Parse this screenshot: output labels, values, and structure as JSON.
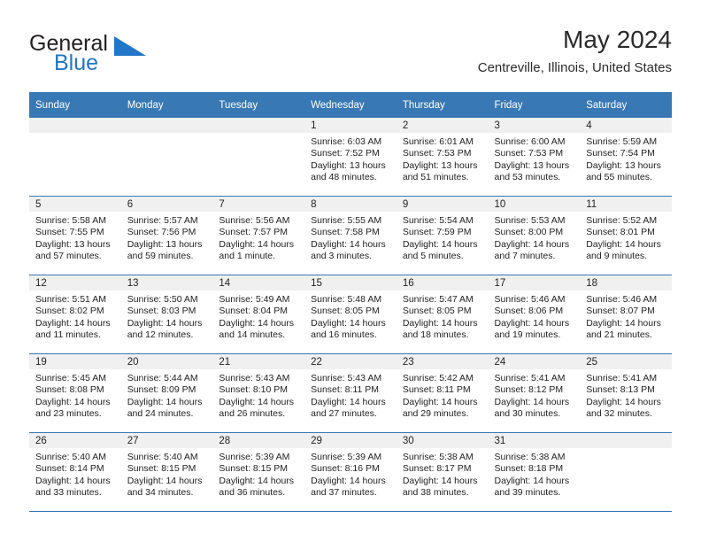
{
  "brand": {
    "name_part1": "General",
    "name_part2": "Blue",
    "triangle_icon": "triangle-logo-icon",
    "colors": {
      "dark": "#231f20",
      "blue": "#2176c7"
    }
  },
  "header": {
    "title": "May 2024",
    "subtitle": "Centreville, Illinois, United States"
  },
  "calendar": {
    "accent_color": "#3878b4",
    "daynum_bg": "#f0f0f0",
    "weekday_headers": [
      "Sunday",
      "Monday",
      "Tuesday",
      "Wednesday",
      "Thursday",
      "Friday",
      "Saturday"
    ],
    "weeks": [
      [
        {
          "day": "",
          "empty": true,
          "sunrise": "",
          "sunset": "",
          "daylight_line1": "",
          "daylight_line2": ""
        },
        {
          "day": "",
          "empty": true,
          "sunrise": "",
          "sunset": "",
          "daylight_line1": "",
          "daylight_line2": ""
        },
        {
          "day": "",
          "empty": true,
          "sunrise": "",
          "sunset": "",
          "daylight_line1": "",
          "daylight_line2": ""
        },
        {
          "day": "1",
          "empty": false,
          "sunrise": "Sunrise: 6:03 AM",
          "sunset": "Sunset: 7:52 PM",
          "daylight_line1": "Daylight: 13 hours",
          "daylight_line2": "and 48 minutes."
        },
        {
          "day": "2",
          "empty": false,
          "sunrise": "Sunrise: 6:01 AM",
          "sunset": "Sunset: 7:53 PM",
          "daylight_line1": "Daylight: 13 hours",
          "daylight_line2": "and 51 minutes."
        },
        {
          "day": "3",
          "empty": false,
          "sunrise": "Sunrise: 6:00 AM",
          "sunset": "Sunset: 7:53 PM",
          "daylight_line1": "Daylight: 13 hours",
          "daylight_line2": "and 53 minutes."
        },
        {
          "day": "4",
          "empty": false,
          "sunrise": "Sunrise: 5:59 AM",
          "sunset": "Sunset: 7:54 PM",
          "daylight_line1": "Daylight: 13 hours",
          "daylight_line2": "and 55 minutes."
        }
      ],
      [
        {
          "day": "5",
          "empty": false,
          "sunrise": "Sunrise: 5:58 AM",
          "sunset": "Sunset: 7:55 PM",
          "daylight_line1": "Daylight: 13 hours",
          "daylight_line2": "and 57 minutes."
        },
        {
          "day": "6",
          "empty": false,
          "sunrise": "Sunrise: 5:57 AM",
          "sunset": "Sunset: 7:56 PM",
          "daylight_line1": "Daylight: 13 hours",
          "daylight_line2": "and 59 minutes."
        },
        {
          "day": "7",
          "empty": false,
          "sunrise": "Sunrise: 5:56 AM",
          "sunset": "Sunset: 7:57 PM",
          "daylight_line1": "Daylight: 14 hours",
          "daylight_line2": "and 1 minute."
        },
        {
          "day": "8",
          "empty": false,
          "sunrise": "Sunrise: 5:55 AM",
          "sunset": "Sunset: 7:58 PM",
          "daylight_line1": "Daylight: 14 hours",
          "daylight_line2": "and 3 minutes."
        },
        {
          "day": "9",
          "empty": false,
          "sunrise": "Sunrise: 5:54 AM",
          "sunset": "Sunset: 7:59 PM",
          "daylight_line1": "Daylight: 14 hours",
          "daylight_line2": "and 5 minutes."
        },
        {
          "day": "10",
          "empty": false,
          "sunrise": "Sunrise: 5:53 AM",
          "sunset": "Sunset: 8:00 PM",
          "daylight_line1": "Daylight: 14 hours",
          "daylight_line2": "and 7 minutes."
        },
        {
          "day": "11",
          "empty": false,
          "sunrise": "Sunrise: 5:52 AM",
          "sunset": "Sunset: 8:01 PM",
          "daylight_line1": "Daylight: 14 hours",
          "daylight_line2": "and 9 minutes."
        }
      ],
      [
        {
          "day": "12",
          "empty": false,
          "sunrise": "Sunrise: 5:51 AM",
          "sunset": "Sunset: 8:02 PM",
          "daylight_line1": "Daylight: 14 hours",
          "daylight_line2": "and 11 minutes."
        },
        {
          "day": "13",
          "empty": false,
          "sunrise": "Sunrise: 5:50 AM",
          "sunset": "Sunset: 8:03 PM",
          "daylight_line1": "Daylight: 14 hours",
          "daylight_line2": "and 12 minutes."
        },
        {
          "day": "14",
          "empty": false,
          "sunrise": "Sunrise: 5:49 AM",
          "sunset": "Sunset: 8:04 PM",
          "daylight_line1": "Daylight: 14 hours",
          "daylight_line2": "and 14 minutes."
        },
        {
          "day": "15",
          "empty": false,
          "sunrise": "Sunrise: 5:48 AM",
          "sunset": "Sunset: 8:05 PM",
          "daylight_line1": "Daylight: 14 hours",
          "daylight_line2": "and 16 minutes."
        },
        {
          "day": "16",
          "empty": false,
          "sunrise": "Sunrise: 5:47 AM",
          "sunset": "Sunset: 8:05 PM",
          "daylight_line1": "Daylight: 14 hours",
          "daylight_line2": "and 18 minutes."
        },
        {
          "day": "17",
          "empty": false,
          "sunrise": "Sunrise: 5:46 AM",
          "sunset": "Sunset: 8:06 PM",
          "daylight_line1": "Daylight: 14 hours",
          "daylight_line2": "and 19 minutes."
        },
        {
          "day": "18",
          "empty": false,
          "sunrise": "Sunrise: 5:46 AM",
          "sunset": "Sunset: 8:07 PM",
          "daylight_line1": "Daylight: 14 hours",
          "daylight_line2": "and 21 minutes."
        }
      ],
      [
        {
          "day": "19",
          "empty": false,
          "sunrise": "Sunrise: 5:45 AM",
          "sunset": "Sunset: 8:08 PM",
          "daylight_line1": "Daylight: 14 hours",
          "daylight_line2": "and 23 minutes."
        },
        {
          "day": "20",
          "empty": false,
          "sunrise": "Sunrise: 5:44 AM",
          "sunset": "Sunset: 8:09 PM",
          "daylight_line1": "Daylight: 14 hours",
          "daylight_line2": "and 24 minutes."
        },
        {
          "day": "21",
          "empty": false,
          "sunrise": "Sunrise: 5:43 AM",
          "sunset": "Sunset: 8:10 PM",
          "daylight_line1": "Daylight: 14 hours",
          "daylight_line2": "and 26 minutes."
        },
        {
          "day": "22",
          "empty": false,
          "sunrise": "Sunrise: 5:43 AM",
          "sunset": "Sunset: 8:11 PM",
          "daylight_line1": "Daylight: 14 hours",
          "daylight_line2": "and 27 minutes."
        },
        {
          "day": "23",
          "empty": false,
          "sunrise": "Sunrise: 5:42 AM",
          "sunset": "Sunset: 8:11 PM",
          "daylight_line1": "Daylight: 14 hours",
          "daylight_line2": "and 29 minutes."
        },
        {
          "day": "24",
          "empty": false,
          "sunrise": "Sunrise: 5:41 AM",
          "sunset": "Sunset: 8:12 PM",
          "daylight_line1": "Daylight: 14 hours",
          "daylight_line2": "and 30 minutes."
        },
        {
          "day": "25",
          "empty": false,
          "sunrise": "Sunrise: 5:41 AM",
          "sunset": "Sunset: 8:13 PM",
          "daylight_line1": "Daylight: 14 hours",
          "daylight_line2": "and 32 minutes."
        }
      ],
      [
        {
          "day": "26",
          "empty": false,
          "sunrise": "Sunrise: 5:40 AM",
          "sunset": "Sunset: 8:14 PM",
          "daylight_line1": "Daylight: 14 hours",
          "daylight_line2": "and 33 minutes."
        },
        {
          "day": "27",
          "empty": false,
          "sunrise": "Sunrise: 5:40 AM",
          "sunset": "Sunset: 8:15 PM",
          "daylight_line1": "Daylight: 14 hours",
          "daylight_line2": "and 34 minutes."
        },
        {
          "day": "28",
          "empty": false,
          "sunrise": "Sunrise: 5:39 AM",
          "sunset": "Sunset: 8:15 PM",
          "daylight_line1": "Daylight: 14 hours",
          "daylight_line2": "and 36 minutes."
        },
        {
          "day": "29",
          "empty": false,
          "sunrise": "Sunrise: 5:39 AM",
          "sunset": "Sunset: 8:16 PM",
          "daylight_line1": "Daylight: 14 hours",
          "daylight_line2": "and 37 minutes."
        },
        {
          "day": "30",
          "empty": false,
          "sunrise": "Sunrise: 5:38 AM",
          "sunset": "Sunset: 8:17 PM",
          "daylight_line1": "Daylight: 14 hours",
          "daylight_line2": "and 38 minutes."
        },
        {
          "day": "31",
          "empty": false,
          "sunrise": "Sunrise: 5:38 AM",
          "sunset": "Sunset: 8:18 PM",
          "daylight_line1": "Daylight: 14 hours",
          "daylight_line2": "and 39 minutes."
        },
        {
          "day": "",
          "empty": true,
          "sunrise": "",
          "sunset": "",
          "daylight_line1": "",
          "daylight_line2": ""
        }
      ]
    ]
  }
}
